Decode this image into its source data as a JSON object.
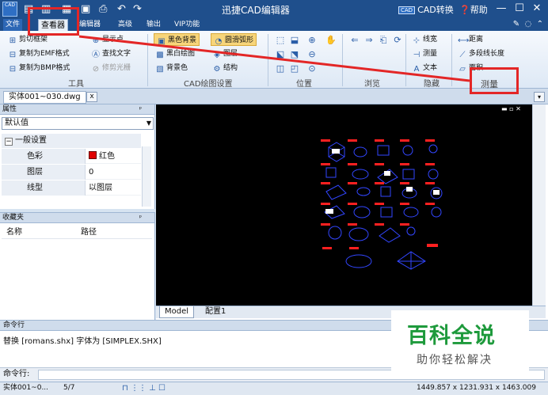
{
  "titlebar": {
    "app_title": "迅捷CAD编辑器",
    "logo_text": "CAD",
    "cad_convert": "CAD转换",
    "cad_convert_box": "CAD",
    "help": "帮助"
  },
  "menu": {
    "file": "文件",
    "viewer": "查看器",
    "editor": "编辑器",
    "advanced": "高级",
    "output": "输出",
    "vip": "VIP功能"
  },
  "ribbon": {
    "tools": {
      "label": "工具",
      "clip_frame": "剪切框架",
      "copy_emf": "复制为EMF格式",
      "copy_bmp": "复制为BMP格式",
      "show_points": "显示点",
      "find_text": "查找文字",
      "trim_raster": "修剪光栅"
    },
    "draw_settings": {
      "label": "CAD绘图设置",
      "black_bg": "黑色背景",
      "bw_draw": "黑白绘图",
      "bg_color": "背景色",
      "smooth_arc": "圆滑弧形",
      "layers": "图层",
      "structure": "结构"
    },
    "position": {
      "label": "位置"
    },
    "browse": {
      "label": "浏览"
    },
    "hidden": {
      "label": "隐藏",
      "line_width": "线宽",
      "measure": "测量",
      "text": "文本"
    },
    "measure": {
      "label": "测量",
      "distance": "距离",
      "polyline_length": "多段线长度",
      "area": "面积"
    }
  },
  "doc_tab": {
    "name": "实体001~030.dwg",
    "close": "x"
  },
  "properties": {
    "header": "属性",
    "combo_value": "默认值",
    "section": "一般设置",
    "rows": [
      {
        "key": "色彩",
        "value": "红色"
      },
      {
        "key": "图层",
        "value": "0"
      },
      {
        "key": "线型",
        "value": "以图层"
      }
    ]
  },
  "favorites": {
    "header": "收藏夹",
    "col_name": "名称",
    "col_path": "路径"
  },
  "layout_tabs": [
    "Model",
    "配置1"
  ],
  "command": {
    "header": "命令行",
    "output": "替换 [romans.shx] 字体为 [SIMPLEX.SHX]",
    "prompt": "命令行:"
  },
  "status": {
    "file": "实体001~0...",
    "page": "5/7",
    "coords": "1449.857 x 1231.931 x 1463.009"
  },
  "watermark": {
    "title": "百科全说",
    "subtitle": "助你轻松解决"
  },
  "colors": {
    "accent_red": "#e32626",
    "title_blue": "#1f4f8c",
    "watermark_green": "#1e9a3c"
  }
}
